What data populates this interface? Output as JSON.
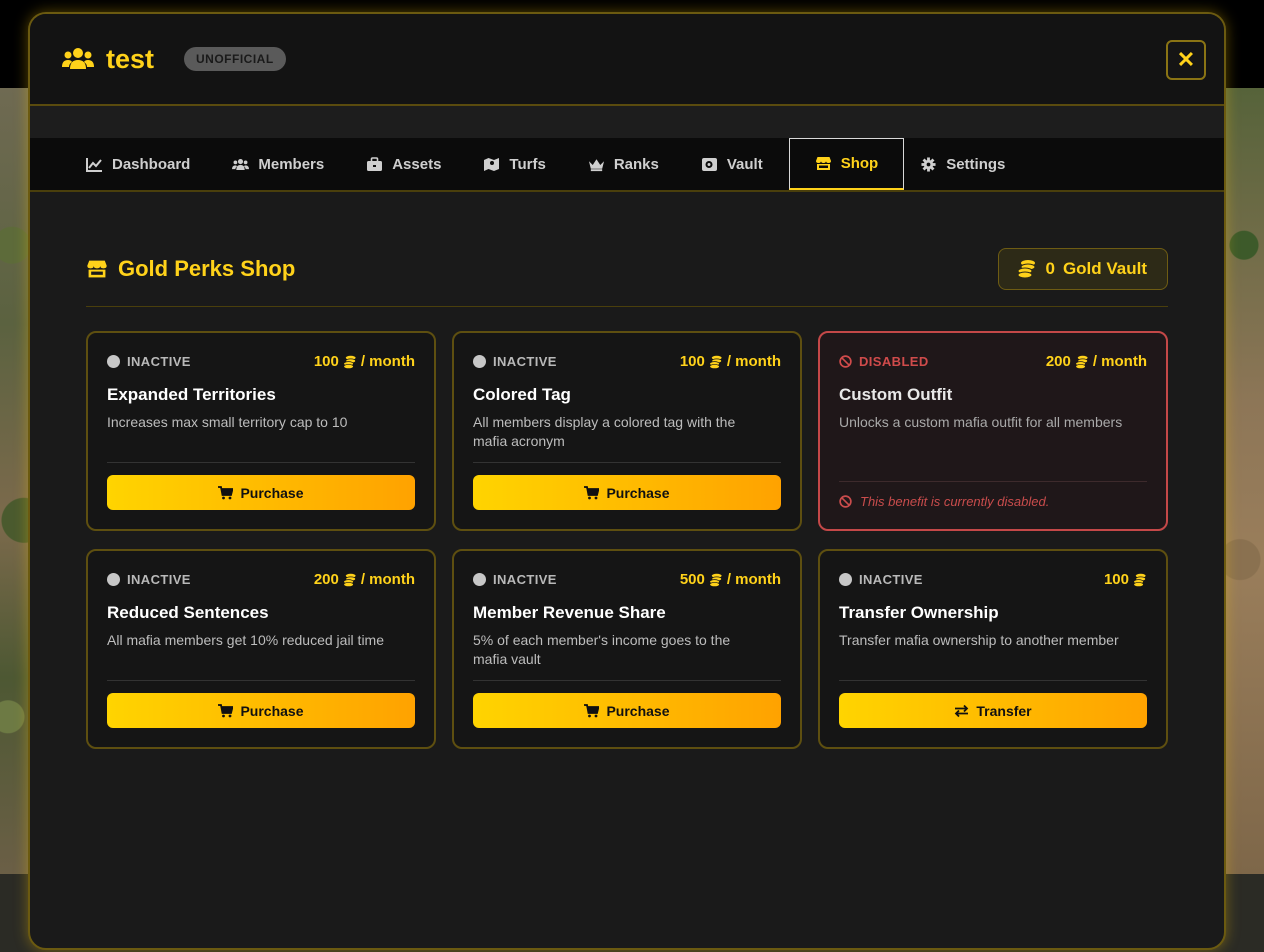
{
  "app": {
    "title": "test",
    "badge": "UNOFFICIAL"
  },
  "tabs": [
    {
      "label": "Dashboard",
      "icon": "chart-line-icon",
      "active": false
    },
    {
      "label": "Members",
      "icon": "users-icon",
      "active": false
    },
    {
      "label": "Assets",
      "icon": "briefcase-icon",
      "active": false
    },
    {
      "label": "Turfs",
      "icon": "map-icon",
      "active": false
    },
    {
      "label": "Ranks",
      "icon": "crown-icon",
      "active": false
    },
    {
      "label": "Vault",
      "icon": "safe-icon",
      "active": false
    },
    {
      "label": "Shop",
      "icon": "store-icon",
      "active": true
    },
    {
      "label": "Settings",
      "icon": "gear-icon",
      "active": false
    }
  ],
  "shop": {
    "title": "Gold Perks Shop",
    "vault_amount": "0",
    "vault_label": "Gold Vault"
  },
  "cards": [
    {
      "status": "INACTIVE",
      "price": "100",
      "price_suffix": "/ month",
      "title": "Expanded Territories",
      "desc": "Increases max small territory cap to 10",
      "button": "Purchase"
    },
    {
      "status": "INACTIVE",
      "price": "100",
      "price_suffix": "/ month",
      "title": "Colored Tag",
      "desc": "All members display a colored tag with the mafia acronym",
      "button": "Purchase"
    },
    {
      "status": "DISABLED",
      "price": "200",
      "price_suffix": "/ month",
      "title": "Custom Outfit",
      "desc": "Unlocks a custom mafia outfit for all members",
      "note": "This benefit is currently disabled."
    },
    {
      "status": "INACTIVE",
      "price": "200",
      "price_suffix": "/ month",
      "title": "Reduced Sentences",
      "desc": "All mafia members get 10% reduced jail time",
      "button": "Purchase"
    },
    {
      "status": "INACTIVE",
      "price": "500",
      "price_suffix": "/ month",
      "title": "Member Revenue Share",
      "desc": "5% of each member's income goes to the mafia vault",
      "button": "Purchase"
    },
    {
      "status": "INACTIVE",
      "price": "100",
      "price_suffix": "",
      "title": "Transfer Ownership",
      "desc": "Transfer mafia ownership to another member",
      "button": "Transfer"
    }
  ],
  "colors": {
    "accent": "#ffd21a",
    "disabled": "#c44848"
  }
}
